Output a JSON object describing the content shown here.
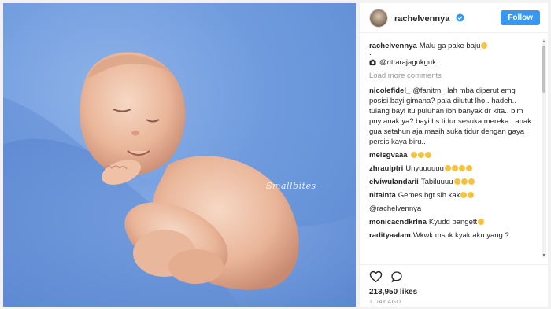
{
  "post": {
    "username": "rachelvennya",
    "follow_label": "Follow",
    "watermark": "Smallbites",
    "caption_user": "rachelvennya",
    "caption_text": "Malu ga pake baju",
    "caption_dot": ".",
    "caption_mention": "@rittarajagukguk",
    "load_more": "Load more comments",
    "likes": "213,950 likes",
    "time": "1 DAY AGO"
  },
  "comments": [
    {
      "user": "nicolefidel_",
      "text": "@fanitrn_ lah mba diperut emg posisi bayi gimana? pala dilutut lho.. hadeh.. tulang bayi itu puluhan lbh banyak dr kita.. blm pny anak ya? bayi bs tidur sesuka mereka.. anak gua setahun aja masih suka tidur dengan gaya persis kaya biru..",
      "emojis": 0
    },
    {
      "user": "melsgvaaa",
      "text": "",
      "emojis": 3
    },
    {
      "user": "zhraulptri",
      "text": "Unyuuuuuu",
      "emojis": 4
    },
    {
      "user": "elviwulandarii",
      "text": "Tabiluuuu",
      "emojis": 3
    },
    {
      "user": "nitainta",
      "text": "Gemes bgt sih kak",
      "emojis": 2
    },
    {
      "user": "",
      "text": "@rachelvennya",
      "emojis": 0
    },
    {
      "user": "monicacndkrlna",
      "text": "Kyudd bangett",
      "emojis": 1
    },
    {
      "user": "radityaalam",
      "text": "Wkwk msok kyak aku yang ?",
      "emojis": 0
    }
  ],
  "colors": {
    "accent": "#3897f0",
    "background": "#6f9bde"
  }
}
